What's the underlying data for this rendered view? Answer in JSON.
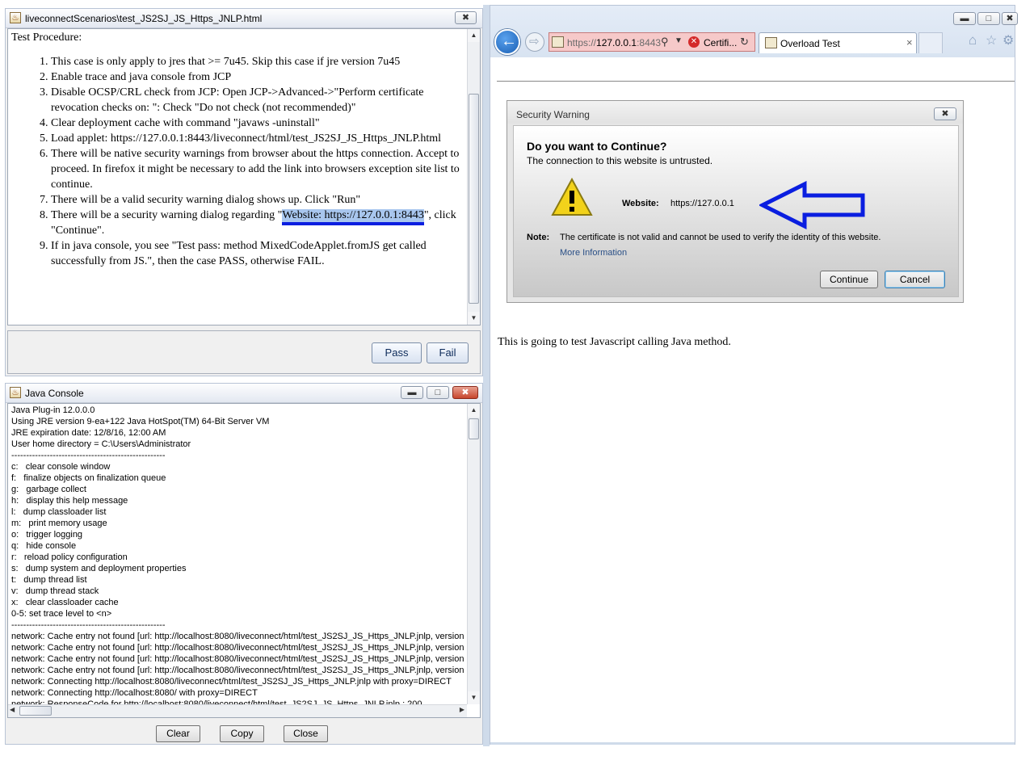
{
  "procedure_window": {
    "title": "liveconnectScenarios\\test_JS2SJ_JS_Https_JNLP.html",
    "heading": "Test Procedure:",
    "steps": [
      "This case is only apply to jres that >= 7u45. Skip this case if jre version 7u45",
      "Enable trace and java console from JCP",
      "Disable OCSP/CRL check from JCP: Open JCP->Advanced->\"Perform certificate revocation checks on: \": Check \"Do not check (not recommended)\"",
      "Clear deployment cache with command \"javaws -uninstall\"",
      "Load applet: https://127.0.0.1:8443/liveconnect/html/test_JS2SJ_JS_Https_JNLP.html",
      "There will be native security warnings from browser about the https connection. Accept to proceed. In firefox it might be necessary to add the link into browsers exception site list to continue.",
      "There will be a valid security warning dialog shows up. Click \"Run\""
    ],
    "step8": {
      "before": "There will be a security warning dialog regarding \"",
      "highlight": "Website: https://127.0.0.1:8443",
      "after": "\", click \"Continue\"."
    },
    "step9": "If in java console, you see \"Test pass: method MixedCodeApplet.fromJS get called successfully from JS.\", then the case PASS, otherwise FAIL.",
    "pass_label": "Pass",
    "fail_label": "Fail"
  },
  "console_window": {
    "title": "Java Console",
    "lines": [
      "Java Plug-in 12.0.0.0",
      "Using JRE version 9-ea+122 Java HotSpot(TM) 64-Bit Server VM",
      "JRE expiration date: 12/8/16, 12:00 AM",
      "User home directory = C:\\Users\\Administrator",
      "----------------------------------------------------",
      "c:   clear console window",
      "f:   finalize objects on finalization queue",
      "g:   garbage collect",
      "h:   display this help message",
      "l:   dump classloader list",
      "m:   print memory usage",
      "o:   trigger logging",
      "q:   hide console",
      "r:   reload policy configuration",
      "s:   dump system and deployment properties",
      "t:   dump thread list",
      "v:   dump thread stack",
      "x:   clear classloader cache",
      "0-5: set trace level to <n>",
      "----------------------------------------------------",
      "network: Cache entry not found [url: http://localhost:8080/liveconnect/html/test_JS2SJ_JS_Https_JNLP.jnlp, version",
      "network: Cache entry not found [url: http://localhost:8080/liveconnect/html/test_JS2SJ_JS_Https_JNLP.jnlp, version",
      "network: Cache entry not found [url: http://localhost:8080/liveconnect/html/test_JS2SJ_JS_Https_JNLP.jnlp, version",
      "network: Cache entry not found [url: http://localhost:8080/liveconnect/html/test_JS2SJ_JS_Https_JNLP.jnlp, version",
      "network: Connecting http://localhost:8080/liveconnect/html/test_JS2SJ_JS_Https_JNLP.jnlp with proxy=DIRECT",
      "network: Connecting http://localhost:8080/ with proxy=DIRECT",
      "network: ResponseCode for http://localhost:8080/liveconnect/html/test_JS2SJ_JS_Https_JNLP.jnlp : 200"
    ],
    "clear_label": "Clear",
    "copy_label": "Copy",
    "close_label": "Close"
  },
  "browser": {
    "address_scheme": "https://",
    "address_host": "127.0.0.1",
    "address_rest": ":8443",
    "cert_label": "Certifi...",
    "tab_title": "Overload Test",
    "page_text": "This is going to test Javascript calling Java method."
  },
  "security_dialog": {
    "title": "Security Warning",
    "heading": "Do you want to Continue?",
    "subheading": "The connection to this website is untrusted.",
    "website_label": "Website:",
    "website_value": "https://127.0.0.1",
    "note_label": "Note:",
    "note_text": "The certificate is not valid and cannot be used to verify the identity of this website.",
    "more_info": "More Information",
    "continue_label": "Continue",
    "cancel_label": "Cancel"
  },
  "colors": {
    "annotation_blue": "#0a1ee0",
    "selection_blue": "#a8c6ee"
  }
}
